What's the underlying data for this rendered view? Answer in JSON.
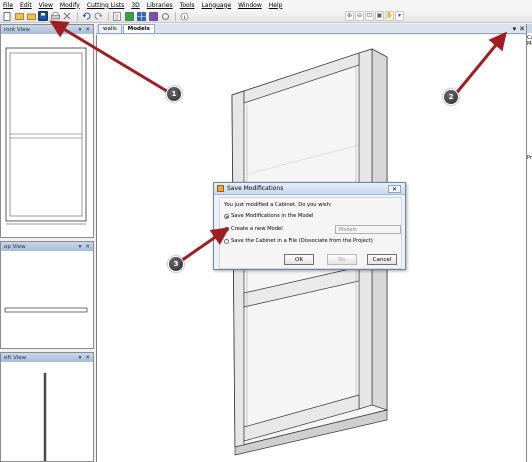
{
  "menu": [
    "File",
    "Edit",
    "View",
    "Modify",
    "Cutting Lists",
    "3D",
    "Libraries",
    "Tools",
    "Language",
    "Window",
    "Help"
  ],
  "panels": {
    "front": {
      "title": "ront View"
    },
    "top": {
      "title": "op View"
    },
    "left": {
      "title": "eft View"
    }
  },
  "tabs": [
    "walls",
    "Models"
  ],
  "doc_controls": {
    "pin": "▾",
    "close": "✕"
  },
  "right_panel": {
    "texts": [
      "Ca",
      "Mo",
      "Pr"
    ]
  },
  "dialog": {
    "title": "Save Modifications",
    "question": "You just modified a Cabinet. Do you wish:",
    "options": [
      {
        "label": "Save Modifications in the Model",
        "selected": true
      },
      {
        "label": "Create a new Model",
        "selected": false
      },
      {
        "label": "Save the Cabinet in a File (Dissociate from the Project)",
        "selected": false
      }
    ],
    "model_name": "Models",
    "ok": "OK",
    "no": "No",
    "cancel": "Cancel"
  },
  "callouts": [
    "1",
    "2",
    "3"
  ],
  "colors": {
    "arrow": "#a01e22",
    "accent": "#2a6fc4"
  },
  "icons": [
    "new-icon",
    "open-icon",
    "folder-icon",
    "save-icon",
    "print-icon",
    "undo-icon",
    "redo-icon",
    "zoom-in-icon",
    "zoom-out-icon",
    "zoom-fit-icon",
    "pan-icon"
  ]
}
